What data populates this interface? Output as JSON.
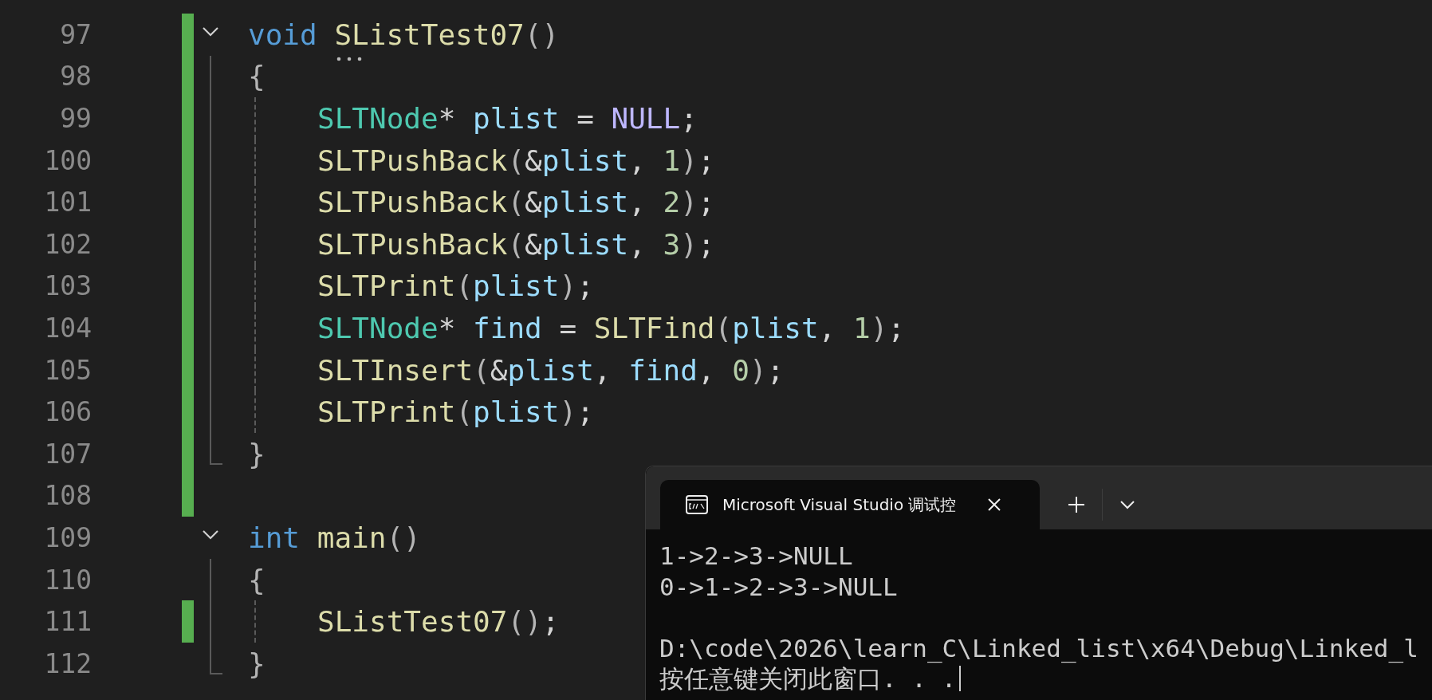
{
  "editor": {
    "lines": [
      {
        "number": "97",
        "changed": true,
        "kind": "fold",
        "hint_dots": true,
        "tokens": [
          {
            "kind": "keyword",
            "text": "void "
          },
          {
            "kind": "func",
            "text": "SListTest07"
          },
          {
            "kind": "punct",
            "text": "()"
          }
        ]
      },
      {
        "number": "98",
        "changed": true,
        "kind": "line",
        "tokens": [
          {
            "kind": "punct",
            "text": "{"
          }
        ]
      },
      {
        "number": "99",
        "changed": true,
        "kind": "inner",
        "tokens": [
          {
            "kind": "type",
            "text": "SLTNode"
          },
          {
            "kind": "plain",
            "text": "* "
          },
          {
            "kind": "var",
            "text": "plist"
          },
          {
            "kind": "plain",
            "text": " = "
          },
          {
            "kind": "macro",
            "text": "NULL"
          },
          {
            "kind": "plain",
            "text": ";"
          }
        ]
      },
      {
        "number": "100",
        "changed": true,
        "kind": "inner",
        "tokens": [
          {
            "kind": "func",
            "text": "SLTPushBack"
          },
          {
            "kind": "punct",
            "text": "("
          },
          {
            "kind": "plain",
            "text": "&"
          },
          {
            "kind": "var",
            "text": "plist"
          },
          {
            "kind": "plain",
            "text": ", "
          },
          {
            "kind": "num",
            "text": "1"
          },
          {
            "kind": "punct",
            "text": ")"
          },
          {
            "kind": "plain",
            "text": ";"
          }
        ]
      },
      {
        "number": "101",
        "changed": true,
        "kind": "inner",
        "tokens": [
          {
            "kind": "func",
            "text": "SLTPushBack"
          },
          {
            "kind": "punct",
            "text": "("
          },
          {
            "kind": "plain",
            "text": "&"
          },
          {
            "kind": "var",
            "text": "plist"
          },
          {
            "kind": "plain",
            "text": ", "
          },
          {
            "kind": "num",
            "text": "2"
          },
          {
            "kind": "punct",
            "text": ")"
          },
          {
            "kind": "plain",
            "text": ";"
          }
        ]
      },
      {
        "number": "102",
        "changed": true,
        "kind": "inner",
        "tokens": [
          {
            "kind": "func",
            "text": "SLTPushBack"
          },
          {
            "kind": "punct",
            "text": "("
          },
          {
            "kind": "plain",
            "text": "&"
          },
          {
            "kind": "var",
            "text": "plist"
          },
          {
            "kind": "plain",
            "text": ", "
          },
          {
            "kind": "num",
            "text": "3"
          },
          {
            "kind": "punct",
            "text": ")"
          },
          {
            "kind": "plain",
            "text": ";"
          }
        ]
      },
      {
        "number": "103",
        "changed": true,
        "kind": "inner",
        "tokens": [
          {
            "kind": "func",
            "text": "SLTPrint"
          },
          {
            "kind": "punct",
            "text": "("
          },
          {
            "kind": "var",
            "text": "plist"
          },
          {
            "kind": "punct",
            "text": ")"
          },
          {
            "kind": "plain",
            "text": ";"
          }
        ]
      },
      {
        "number": "104",
        "changed": true,
        "kind": "inner",
        "tokens": [
          {
            "kind": "type",
            "text": "SLTNode"
          },
          {
            "kind": "plain",
            "text": "* "
          },
          {
            "kind": "var",
            "text": "find"
          },
          {
            "kind": "plain",
            "text": " = "
          },
          {
            "kind": "func",
            "text": "SLTFind"
          },
          {
            "kind": "punct",
            "text": "("
          },
          {
            "kind": "var",
            "text": "plist"
          },
          {
            "kind": "plain",
            "text": ", "
          },
          {
            "kind": "num",
            "text": "1"
          },
          {
            "kind": "punct",
            "text": ")"
          },
          {
            "kind": "plain",
            "text": ";"
          }
        ]
      },
      {
        "number": "105",
        "changed": true,
        "kind": "inner",
        "tokens": [
          {
            "kind": "func",
            "text": "SLTInsert"
          },
          {
            "kind": "punct",
            "text": "("
          },
          {
            "kind": "plain",
            "text": "&"
          },
          {
            "kind": "var",
            "text": "plist"
          },
          {
            "kind": "plain",
            "text": ", "
          },
          {
            "kind": "var",
            "text": "find"
          },
          {
            "kind": "plain",
            "text": ", "
          },
          {
            "kind": "num",
            "text": "0"
          },
          {
            "kind": "punct",
            "text": ")"
          },
          {
            "kind": "plain",
            "text": ";"
          }
        ]
      },
      {
        "number": "106",
        "changed": true,
        "kind": "inner",
        "tokens": [
          {
            "kind": "func",
            "text": "SLTPrint"
          },
          {
            "kind": "punct",
            "text": "("
          },
          {
            "kind": "var",
            "text": "plist"
          },
          {
            "kind": "punct",
            "text": ")"
          },
          {
            "kind": "plain",
            "text": ";"
          }
        ]
      },
      {
        "number": "107",
        "changed": true,
        "kind": "end",
        "tokens": [
          {
            "kind": "punct",
            "text": "}"
          }
        ]
      },
      {
        "number": "108",
        "changed": true,
        "kind": "blank"
      },
      {
        "number": "109",
        "changed": false,
        "kind": "fold",
        "tokens": [
          {
            "kind": "keyword",
            "text": "int "
          },
          {
            "kind": "func",
            "text": "main"
          },
          {
            "kind": "punct",
            "text": "()"
          }
        ]
      },
      {
        "number": "110",
        "changed": false,
        "kind": "line",
        "tokens": [
          {
            "kind": "punct",
            "text": "{"
          }
        ]
      },
      {
        "number": "111",
        "changed": true,
        "kind": "inner",
        "tokens": [
          {
            "kind": "func",
            "text": "SListTest07"
          },
          {
            "kind": "punct",
            "text": "()"
          },
          {
            "kind": "plain",
            "text": ";"
          }
        ]
      },
      {
        "number": "112",
        "changed": false,
        "kind": "end",
        "tokens": [
          {
            "kind": "punct",
            "text": "}"
          }
        ]
      }
    ]
  },
  "terminal": {
    "tab": {
      "title": "Microsoft Visual Studio 调试控",
      "selected": true
    },
    "output": [
      {
        "kind": "text",
        "text": "1->2->3->NULL"
      },
      {
        "kind": "text",
        "text": "0->1->2->3->NULL"
      },
      {
        "kind": "blank"
      },
      {
        "kind": "text",
        "text": "D:\\code\\2026\\learn_C\\Linked_list\\x64\\Debug\\Linked_l"
      },
      {
        "kind": "text",
        "text": "按任意键关闭此窗口. . ."
      }
    ],
    "cursor": true
  }
}
